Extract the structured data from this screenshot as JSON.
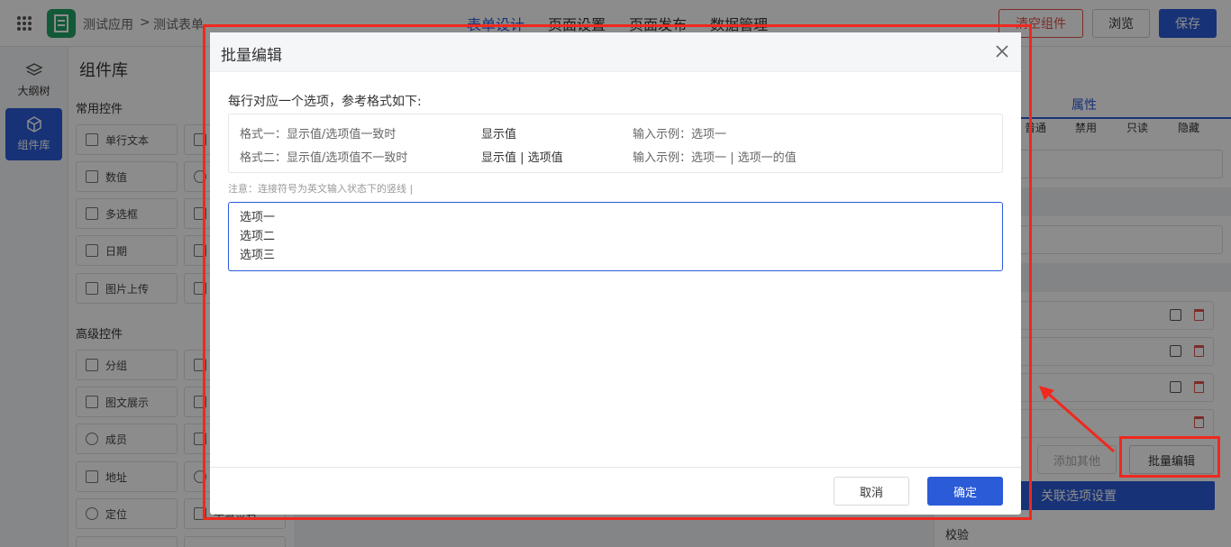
{
  "app": {
    "breadcrumb_app": "测试应用",
    "breadcrumb_sep": ">",
    "breadcrumb_form": "测试表单"
  },
  "top_tabs": [
    {
      "label": "表单设计",
      "active": true
    },
    {
      "label": "页面设置",
      "active": false
    },
    {
      "label": "页面发布",
      "active": false
    },
    {
      "label": "数据管理",
      "active": false
    }
  ],
  "toolbar": {
    "clear_label": "清空组件",
    "preview_label": "浏览",
    "save_label": "保存"
  },
  "leftnav": {
    "outline_label": "大纲树",
    "library_label": "组件库"
  },
  "library": {
    "title": "组件库",
    "common_section": "常用控件",
    "advanced_section": "高级控件",
    "common_items": [
      "单行文本",
      "数值",
      "多选框",
      "日期",
      "图片上传"
    ],
    "advanced_items": [
      "分组",
      "图文展示",
      "成员",
      "地址",
      "定位"
    ],
    "partial_text": "手写签名"
  },
  "right_panel": {
    "tab_label": "属性",
    "modes": [
      "普通",
      "禁用",
      "只读",
      "隐藏"
    ],
    "add_other_label": "添加其他",
    "batch_edit_label": "批量编辑",
    "assoc_label": "关联选项设置",
    "verify_label": "校验"
  },
  "modal": {
    "title": "批量编辑",
    "instruction": "每行对应一个选项，参考格式如下:",
    "formats": [
      {
        "pattern": "格式一：显示值/选项值一致时",
        "value": "显示值",
        "example": "输入示例：选项一"
      },
      {
        "pattern": "格式二：显示值/选项值不一致时",
        "value": "显示值 | 选项值",
        "example": "输入示例：选项一 | 选项一的值"
      }
    ],
    "note": "注意：连接符号为英文输入状态下的竖线 |",
    "textarea_lines": [
      "选项一",
      "选项二",
      "选项三"
    ],
    "cancel_label": "取消",
    "confirm_label": "确定"
  },
  "colors": {
    "primary": "#2b5bd7",
    "danger": "#e0514c",
    "annotation": "#f0281e",
    "app_logo": "#21a366"
  }
}
